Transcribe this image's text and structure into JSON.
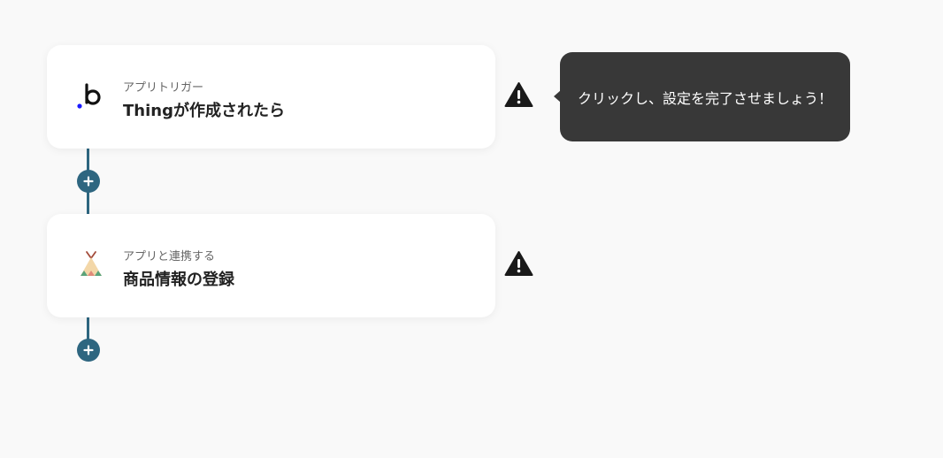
{
  "flow": {
    "steps": [
      {
        "label": "アプリトリガー",
        "title": "Thingが作成されたら",
        "icon": "bubble-app-icon",
        "warning_icon": "warning-icon"
      },
      {
        "label": "アプリと連携する",
        "title": "商品情報の登録",
        "icon": "teepee-app-icon",
        "warning_icon": "warning-icon"
      }
    ],
    "add_step_icon": "plus-icon"
  },
  "tooltip": {
    "text": "クリックし、設定を完了させましょう！"
  },
  "colors": {
    "background": "#f9f9f9",
    "connector": "#2e6680",
    "tooltip_bg": "#383838",
    "card_bg": "#ffffff",
    "warning": "#1a1a1a"
  }
}
